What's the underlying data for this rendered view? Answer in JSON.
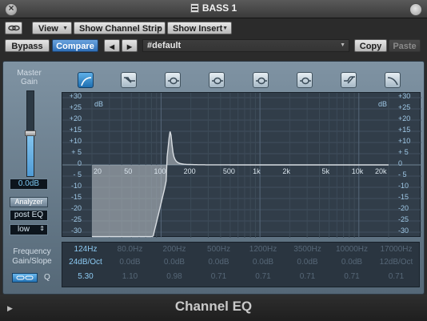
{
  "window": {
    "title": "BASS 1"
  },
  "toolbar": {
    "view_label": "View",
    "channel_strip_label": "Show Channel Strip",
    "insert_label": "Show Insert",
    "bypass_label": "Bypass",
    "compare_label": "Compare",
    "prev_label": "◀",
    "next_label": "▶",
    "preset_value": "#default",
    "copy_label": "Copy",
    "paste_label": "Paste"
  },
  "left_panel": {
    "gain_label_1": "Master",
    "gain_label_2": "Gain",
    "gain_value": "0.0dB",
    "gain_level_fraction": 0.5,
    "analyzer_label": "Analyzer",
    "analyzer_mode": "post EQ",
    "analyzer_resolution": "low"
  },
  "bands": [
    {
      "icon": "low-cut-icon",
      "active": true
    },
    {
      "icon": "low-shelf-icon",
      "active": false
    },
    {
      "icon": "bell-icon",
      "active": false
    },
    {
      "icon": "bell-icon",
      "active": false
    },
    {
      "icon": "bell-icon",
      "active": false
    },
    {
      "icon": "bell-icon",
      "active": false
    },
    {
      "icon": "high-shelf-icon",
      "active": false
    },
    {
      "icon": "high-cut-icon",
      "active": false
    }
  ],
  "graph": {
    "unit_label": "dB",
    "db_ticks": [
      "+30",
      "+25",
      "+20",
      "+15",
      "+10",
      "+ 5",
      "0",
      "- 5",
      "-10",
      "-15",
      "-20",
      "-25",
      "-30"
    ],
    "freq_ticks": [
      "20",
      "50",
      "100",
      "200",
      "500",
      "1k",
      "2k",
      "5k",
      "10k",
      "20k"
    ],
    "freq_values": [
      20,
      50,
      100,
      200,
      500,
      1000,
      2000,
      5000,
      10000,
      20000
    ],
    "curve_peak_db": 15,
    "curve_peak_hz": 124
  },
  "params": {
    "labels": [
      "Frequency",
      "Gain/Slope",
      "Q"
    ],
    "frequency": [
      "124Hz",
      "80.0Hz",
      "200Hz",
      "500Hz",
      "1200Hz",
      "3500Hz",
      "10000Hz",
      "17000Hz"
    ],
    "gain": [
      "24dB/Oct",
      "0.0dB",
      "0.0dB",
      "0.0dB",
      "0.0dB",
      "0.0dB",
      "0.0dB",
      "12dB/Oct"
    ],
    "q": [
      "5.30",
      "1.10",
      "0.98",
      "0.71",
      "0.71",
      "0.71",
      "0.71",
      "0.71"
    ]
  },
  "footer": {
    "plugin_name": "Channel EQ"
  }
}
